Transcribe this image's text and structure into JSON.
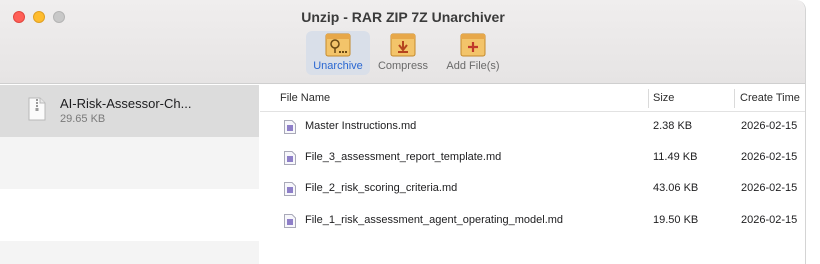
{
  "window": {
    "title": "Unzip - RAR ZIP 7Z Unarchiver"
  },
  "toolbar": {
    "unarchive_label": "Unarchive",
    "compress_label": "Compress",
    "add_files_label": "Add File(s)"
  },
  "sidebar": {
    "archive": {
      "name": "AI-Risk-Assessor-Ch...",
      "size": "29.65 KB"
    }
  },
  "file_list": {
    "columns": {
      "name": "File Name",
      "size": "Size",
      "created": "Create Time"
    },
    "rows": [
      {
        "name": "Master Instructions.md",
        "size": "2.38 KB",
        "created": "2026-02-15"
      },
      {
        "name": "File_3_assessment_report_template.md",
        "size": "11.49 KB",
        "created": "2026-02-15"
      },
      {
        "name": "File_2_risk_scoring_criteria.md",
        "size": "43.06 KB",
        "created": "2026-02-15"
      },
      {
        "name": "File_1_risk_assessment_agent_operating_model.md",
        "size": "19.50 KB",
        "created": "2026-02-15"
      }
    ]
  },
  "colors": {
    "accent": "#2a67d1",
    "close": "#ff5f57",
    "minimize": "#febc2e"
  },
  "icons": [
    "unarchive-icon",
    "compress-icon",
    "add-file-icon",
    "zip-file-icon",
    "markdown-file-icon"
  ]
}
